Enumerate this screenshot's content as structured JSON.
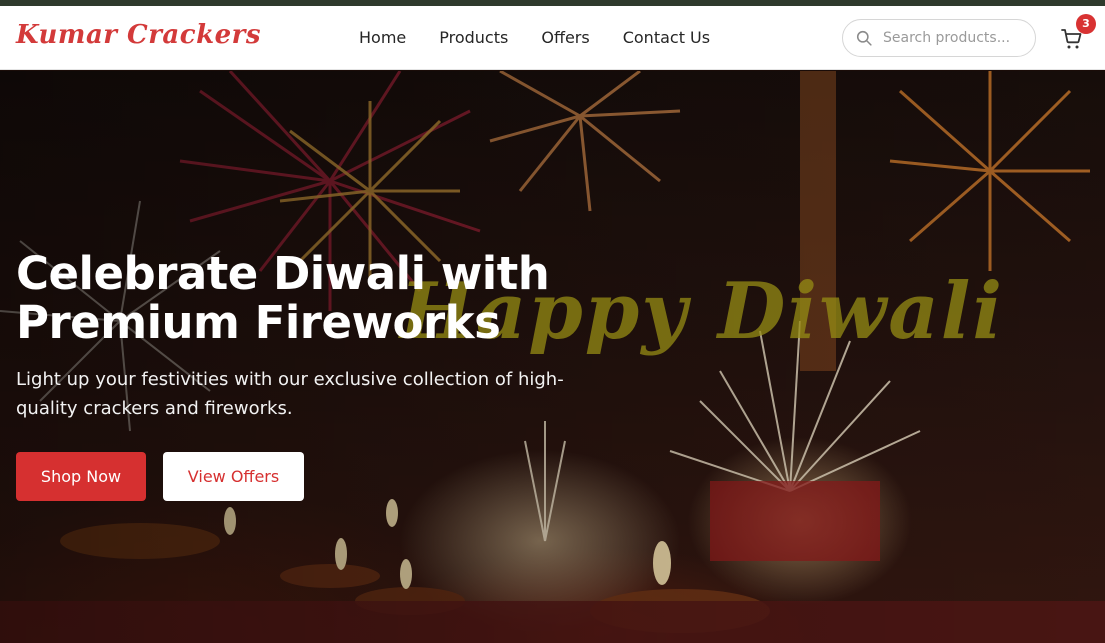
{
  "brand": {
    "logo": "Kumar Crackers"
  },
  "nav": {
    "items": [
      "Home",
      "Products",
      "Offers",
      "Contact Us"
    ]
  },
  "search": {
    "placeholder": "Search products..."
  },
  "cart": {
    "count": "3"
  },
  "hero": {
    "title": "Celebrate Diwali with Premium Fireworks",
    "subtitle": "Light up your festivities with our exclusive collection of high-quality crackers and fireworks.",
    "background_text": "Happy Diwali",
    "primary_button": "Shop Now",
    "secondary_button": "View Offers"
  },
  "colors": {
    "accent": "#d63030",
    "header_bg": "#ffffff"
  }
}
